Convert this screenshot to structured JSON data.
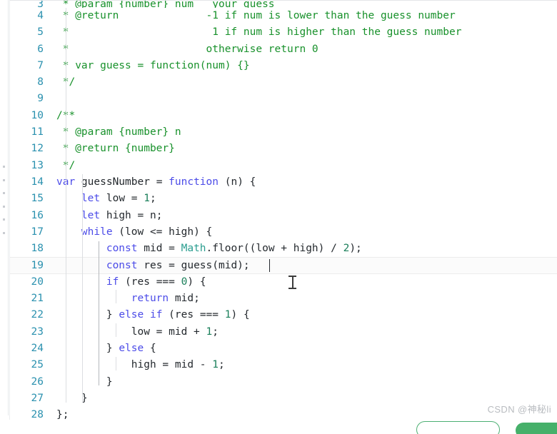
{
  "editor": {
    "language": "javascript",
    "active_line": 19,
    "caret": {
      "line": 19,
      "column": 25
    },
    "colors": {
      "comment": "#18912b",
      "keyword": "#4b4be8",
      "type": "#2a9d8f",
      "number": "#1a7f5a",
      "plain": "#24292e",
      "line_number": "#2b91af",
      "active_line_bg": "#fbfbfb",
      "indent_guide": "#dcdee1",
      "active_indent_guide": "#b5b8bc"
    },
    "lines": [
      {
        "number": "3",
        "partial": true,
        "tokens": [
          {
            "t": " * @param {number} num   your guess",
            "c": "c-comment"
          }
        ]
      },
      {
        "number": "4",
        "tokens": [
          {
            "t": " * @return              -1 if num is lower than the guess number",
            "c": "c-comment"
          }
        ]
      },
      {
        "number": "5",
        "tokens": [
          {
            "t": " *                       1 if num is higher than the guess number",
            "c": "c-comment"
          }
        ]
      },
      {
        "number": "6",
        "tokens": [
          {
            "t": " *                      otherwise return 0",
            "c": "c-comment"
          }
        ]
      },
      {
        "number": "7",
        "tokens": [
          {
            "t": " * var guess = function(num) {}",
            "c": "c-comment"
          }
        ]
      },
      {
        "number": "8",
        "tokens": [
          {
            "t": " */",
            "c": "c-comment"
          }
        ]
      },
      {
        "number": "9",
        "tokens": []
      },
      {
        "number": "10",
        "tokens": [
          {
            "t": "/**",
            "c": "c-comment"
          }
        ]
      },
      {
        "number": "11",
        "tokens": [
          {
            "t": " * @param {number} n",
            "c": "c-comment"
          }
        ]
      },
      {
        "number": "12",
        "tokens": [
          {
            "t": " * @return {number}",
            "c": "c-comment"
          }
        ]
      },
      {
        "number": "13",
        "tokens": [
          {
            "t": " */",
            "c": "c-comment"
          }
        ]
      },
      {
        "number": "14",
        "tokens": [
          {
            "t": "var",
            "c": "c-kw"
          },
          {
            "t": " guessNumber = ",
            "c": "c-plain"
          },
          {
            "t": "function",
            "c": "c-kw"
          },
          {
            "t": " (n) {",
            "c": "c-plain"
          }
        ]
      },
      {
        "number": "15",
        "tokens": [
          {
            "t": "    ",
            "c": "c-plain"
          },
          {
            "t": "let",
            "c": "c-kw"
          },
          {
            "t": " low = ",
            "c": "c-plain"
          },
          {
            "t": "1",
            "c": "c-num"
          },
          {
            "t": ";",
            "c": "c-plain"
          }
        ]
      },
      {
        "number": "16",
        "tokens": [
          {
            "t": "    ",
            "c": "c-plain"
          },
          {
            "t": "let",
            "c": "c-kw"
          },
          {
            "t": " high = n;",
            "c": "c-plain"
          }
        ]
      },
      {
        "number": "17",
        "tokens": [
          {
            "t": "    ",
            "c": "c-plain"
          },
          {
            "t": "while",
            "c": "c-kw"
          },
          {
            "t": " (low <= high) {",
            "c": "c-plain"
          }
        ]
      },
      {
        "number": "18",
        "tokens": [
          {
            "t": "        ",
            "c": "c-plain"
          },
          {
            "t": "const",
            "c": "c-kw"
          },
          {
            "t": " mid = ",
            "c": "c-plain"
          },
          {
            "t": "Math",
            "c": "c-type"
          },
          {
            "t": ".floor((low + high) / ",
            "c": "c-plain"
          },
          {
            "t": "2",
            "c": "c-num"
          },
          {
            "t": ");",
            "c": "c-plain"
          }
        ]
      },
      {
        "number": "19",
        "active": true,
        "tokens": [
          {
            "t": "        ",
            "c": "c-plain"
          },
          {
            "t": "const",
            "c": "c-kw"
          },
          {
            "t": " res = guess(mid);",
            "c": "c-plain"
          }
        ]
      },
      {
        "number": "20",
        "tokens": [
          {
            "t": "        ",
            "c": "c-plain"
          },
          {
            "t": "if",
            "c": "c-kw"
          },
          {
            "t": " (res === ",
            "c": "c-plain"
          },
          {
            "t": "0",
            "c": "c-num"
          },
          {
            "t": ") {",
            "c": "c-plain"
          }
        ]
      },
      {
        "number": "21",
        "tokens": [
          {
            "t": "            ",
            "c": "c-plain"
          },
          {
            "t": "return",
            "c": "c-kw"
          },
          {
            "t": " mid;",
            "c": "c-plain"
          }
        ]
      },
      {
        "number": "22",
        "tokens": [
          {
            "t": "        } ",
            "c": "c-plain"
          },
          {
            "t": "else",
            "c": "c-kw"
          },
          {
            "t": " ",
            "c": "c-plain"
          },
          {
            "t": "if",
            "c": "c-kw"
          },
          {
            "t": " (res === ",
            "c": "c-plain"
          },
          {
            "t": "1",
            "c": "c-num"
          },
          {
            "t": ") {",
            "c": "c-plain"
          }
        ]
      },
      {
        "number": "23",
        "tokens": [
          {
            "t": "            low = mid + ",
            "c": "c-plain"
          },
          {
            "t": "1",
            "c": "c-num"
          },
          {
            "t": ";",
            "c": "c-plain"
          }
        ]
      },
      {
        "number": "24",
        "tokens": [
          {
            "t": "        } ",
            "c": "c-plain"
          },
          {
            "t": "else",
            "c": "c-kw"
          },
          {
            "t": " {",
            "c": "c-plain"
          }
        ]
      },
      {
        "number": "25",
        "tokens": [
          {
            "t": "            high = mid - ",
            "c": "c-plain"
          },
          {
            "t": "1",
            "c": "c-num"
          },
          {
            "t": ";",
            "c": "c-plain"
          }
        ]
      },
      {
        "number": "26",
        "tokens": [
          {
            "t": "        }",
            "c": "c-plain"
          }
        ]
      },
      {
        "number": "27",
        "tokens": [
          {
            "t": "    }",
            "c": "c-plain"
          }
        ]
      },
      {
        "number": "28",
        "tokens": [
          {
            "t": "};",
            "c": "c-plain"
          }
        ]
      }
    ]
  },
  "footer": {
    "watermark": "CSDN @神秘li",
    "buttons": [
      {
        "name": "secondary-action-button",
        "label": "",
        "style": "outline",
        "color": "#4caf72"
      },
      {
        "name": "primary-action-button",
        "label": "",
        "style": "solid",
        "color": "#46b06a"
      }
    ]
  },
  "scrollbar": {
    "orientation": "vertical",
    "position": "left-rail"
  }
}
